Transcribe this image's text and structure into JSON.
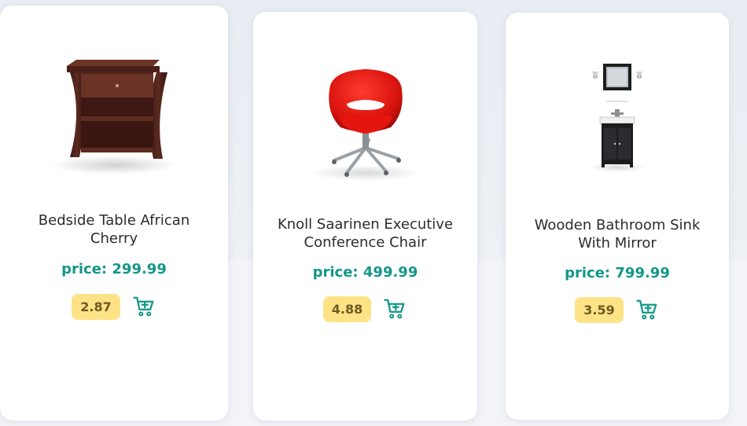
{
  "accent_color": "#139787",
  "badge_color": "#fde386",
  "products": [
    {
      "name": "Bedside Table African Cherry",
      "price_text": "price: 299.99",
      "rating": "2.87",
      "image": "bedside-table-image",
      "cart_icon": "add-to-cart-icon"
    },
    {
      "name": "Knoll Saarinen Executive Conference Chair",
      "price_text": "price: 499.99",
      "rating": "4.88",
      "image": "office-chair-image",
      "cart_icon": "add-to-cart-icon"
    },
    {
      "name": "Wooden Bathroom Sink With Mirror",
      "price_text": "price: 799.99",
      "rating": "3.59",
      "image": "bathroom-sink-image",
      "cart_icon": "add-to-cart-icon"
    }
  ]
}
